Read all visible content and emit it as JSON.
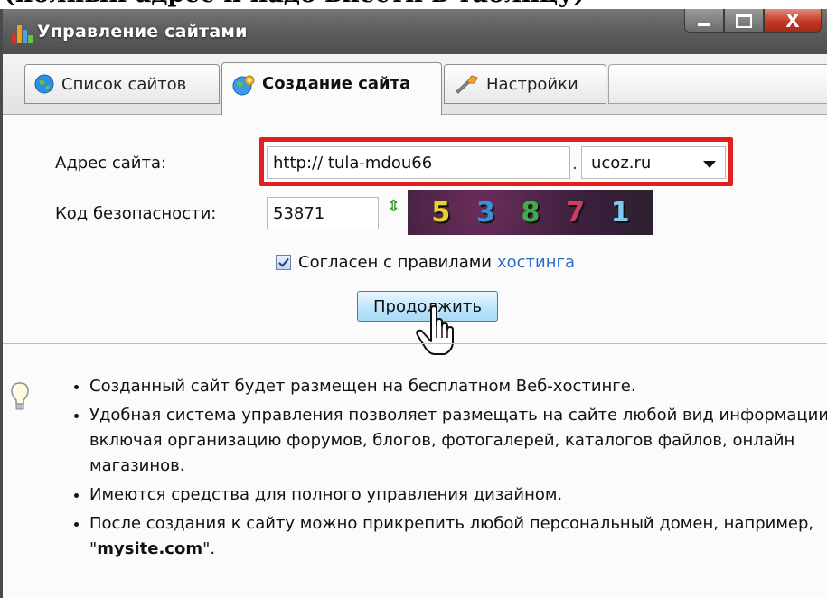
{
  "caption": "(полный адрес и надо внести в таблицу)",
  "window": {
    "title": "Управление сайтами",
    "controls": {
      "minimize": "▬",
      "maximize": "▭",
      "close": "X"
    }
  },
  "tabs": [
    {
      "label": "Список сайтов",
      "active": false
    },
    {
      "label": "Создание сайта",
      "active": true
    },
    {
      "label": "Настройки",
      "active": false
    }
  ],
  "form": {
    "address_label": "Адрес сайта:",
    "address_value": "http:// tula-mdou66",
    "domain_separator": ".",
    "domain_value": "ucoz.ru",
    "security_label": "Код безопасности:",
    "security_value": "53871",
    "captcha_chars": [
      {
        "char": "5",
        "color": "#e8d22a"
      },
      {
        "char": "3",
        "color": "#3b8fd8"
      },
      {
        "char": "8",
        "color": "#3fae4a"
      },
      {
        "char": "7",
        "color": "#d03b6a"
      },
      {
        "char": "1",
        "color": "#7fc8f0"
      }
    ],
    "agree_text": "Согласен с правилами",
    "agree_link": "хостинга",
    "agree_checked": true,
    "continue_label": "Продолжить"
  },
  "info": {
    "bullets": [
      "Созданный сайт будет размещен на бесплатном Веб-хостинге.",
      "Удобная система управления позволяет размещать на сайте любой вид информации, включая организацию форумов, блогов, фотогалерей, каталогов файлов, онлайн магазинов.",
      "Имеются средства для полного управления дизайном."
    ],
    "last_bullet_prefix": "После создания к сайту можно прикрепить любой персональный домен, например, \"",
    "last_bullet_domain": "mysite.com",
    "last_bullet_suffix": "\"."
  },
  "colors": {
    "highlight": "#e02020",
    "link": "#2a6fc2",
    "accent_button": "#bee6fd"
  },
  "icons": [
    "app-icon",
    "globe-icon",
    "globe-gear-icon",
    "wrench-icon",
    "refresh-icon",
    "hand-cursor-icon",
    "lightbulb-icon"
  ]
}
